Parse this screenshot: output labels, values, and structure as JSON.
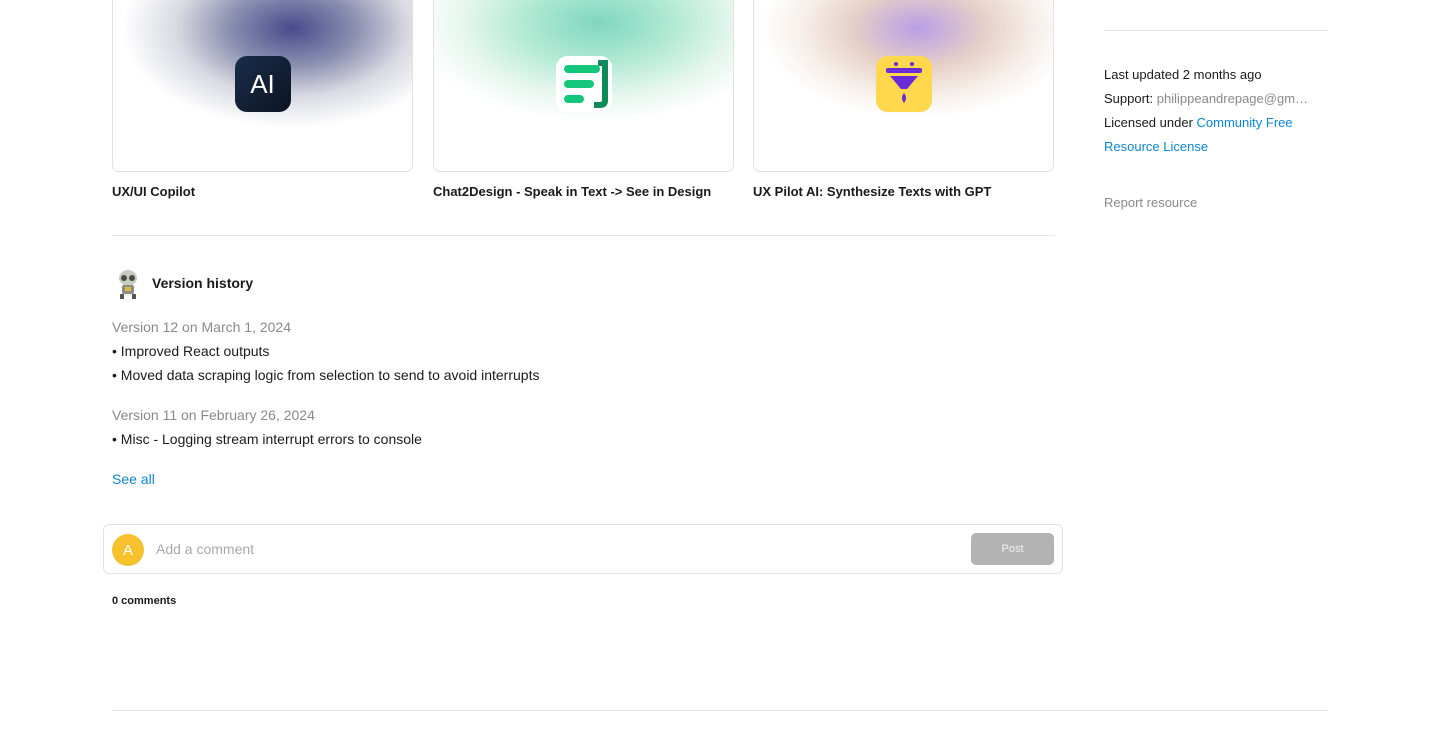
{
  "related_plugins": [
    {
      "title": "UX/UI Copilot",
      "icon": "ai-logo-icon",
      "icon_text": "AI"
    },
    {
      "title": "Chat2Design - Speak in Text -> See in Design",
      "icon": "chat-lines-icon"
    },
    {
      "title": "UX Pilot AI: Synthesize Texts with GPT",
      "icon": "funnel-icon"
    }
  ],
  "sidebar": {
    "last_updated": "Last updated 2 months ago",
    "support_label": "Support:",
    "support_value": "philippeandrepage@gm…",
    "license_label": "Licensed under",
    "license_link_line1": "Community Free",
    "license_link_line2": "Resource License",
    "report": "Report resource"
  },
  "version_history": {
    "title": "Version history",
    "versions": [
      {
        "heading": "Version 12 on March 1, 2024",
        "notes": [
          "• Improved React outputs",
          "• Moved data scraping logic from selection to send to avoid interrupts"
        ]
      },
      {
        "heading": "Version 11 on February 26, 2024",
        "notes": [
          "• Misc - Logging stream interrupt errors to console"
        ]
      }
    ],
    "see_all": "See all"
  },
  "comments": {
    "avatar_letter": "A",
    "placeholder": "Add a comment",
    "post_label": "Post",
    "count_text": "0 comments"
  },
  "colors": {
    "link": "#0d86d1",
    "avatar": "#f7c12e",
    "post_button": "#b3b3b3",
    "chat_icon_green": "#14c77a",
    "funnel_bg": "#ffd84d",
    "funnel_purple": "#6a2bd8"
  }
}
